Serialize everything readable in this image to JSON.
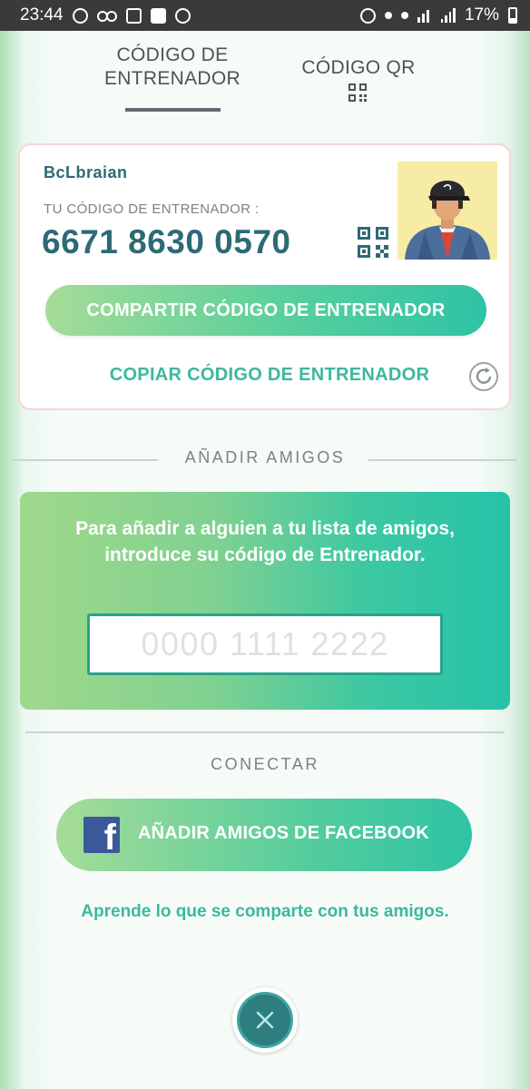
{
  "status_bar": {
    "time": "23:44",
    "battery": "17%"
  },
  "tabs": [
    {
      "label_line1": "CÓDIGO DE",
      "label_line2": "ENTRENADOR",
      "active": true
    },
    {
      "label": "CÓDIGO QR",
      "icon": "qr-icon",
      "active": false
    }
  ],
  "trainer_card": {
    "username": "BcLbraian",
    "code_label": "TU CÓDIGO DE ENTRENADOR :",
    "code": "6671 8630 0570",
    "share_button": "COMPARTIR CÓDIGO DE ENTRENADOR",
    "copy_link": "COPIAR CÓDIGO DE ENTRENADOR"
  },
  "add_friends": {
    "title": "AÑADIR AMIGOS",
    "description": "Para añadir a alguien a tu lista de amigos, introduce su código de Entrenador.",
    "input_placeholder": "0000 1111 2222",
    "input_value": ""
  },
  "connect": {
    "title": "CONECTAR",
    "facebook_button": "AÑADIR AMIGOS DE FACEBOOK",
    "learn_link": "Aprende lo que se comparte con tus amigos."
  },
  "colors": {
    "accent_teal": "#2d6a76",
    "link_green": "#3cb89e",
    "facebook_blue": "#3b5998"
  }
}
